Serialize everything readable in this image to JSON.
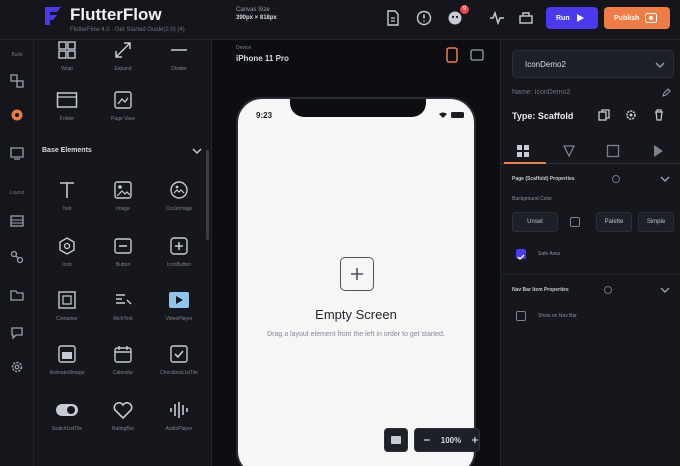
{
  "app": {
    "brand": "FlutterFlow",
    "brand_sub": "FlutterFlow 4.0 · Get Started Guide(2.0) (4)",
    "canvas_label": "Canvas Size",
    "canvas_value": "390px × 818px"
  },
  "toolbar": {
    "notification_count": "9",
    "run_label": "Run",
    "publish_label": "Publish"
  },
  "rail": {
    "build_label": "Build",
    "layout_label": "Layout"
  },
  "panel": {
    "top_row": [
      {
        "label": "Wrap",
        "icon": "grid-icon"
      },
      {
        "label": "Expand",
        "icon": "expand-icon"
      },
      {
        "label": "Divider",
        "icon": "divider-icon"
      }
    ],
    "second_row": [
      {
        "label": "Folder",
        "icon": "folder-icon"
      },
      {
        "label": "Page View",
        "icon": "page-view-icon"
      }
    ],
    "section_title": "Base Elements",
    "rows": [
      [
        {
          "label": "Text",
          "icon": "text-icon"
        },
        {
          "label": "Image",
          "icon": "image-icon"
        },
        {
          "label": "CircleImage",
          "icon": "circle-image-icon"
        }
      ],
      [
        {
          "label": "Icon",
          "icon": "hex-icon"
        },
        {
          "label": "Button",
          "icon": "button-icon"
        },
        {
          "label": "IconButton",
          "icon": "icon-button-icon"
        }
      ],
      [
        {
          "label": "Container",
          "icon": "container-icon"
        },
        {
          "label": "RichText",
          "icon": "rich-text-icon"
        },
        {
          "label": "VideoPlayer",
          "icon": "video-icon"
        }
      ],
      [
        {
          "label": "AnimatedImage",
          "icon": "animated-image-icon"
        },
        {
          "label": "Calendar",
          "icon": "calendar-icon"
        },
        {
          "label": "CheckboxListTile",
          "icon": "checkbox-icon"
        }
      ],
      [
        {
          "label": "SwitchListTile",
          "icon": "toggle-icon"
        },
        {
          "label": "RatingBar",
          "icon": "heart-icon"
        },
        {
          "label": "AudioPlayer",
          "icon": "waveform-icon"
        }
      ]
    ]
  },
  "canvas": {
    "device_label": "Device",
    "device_name": "iPhone 11 Pro",
    "time": "9:23",
    "empty_title": "Empty Screen",
    "empty_subtitle": "Drag a layout element from the left in order to get started.",
    "zoom": "100%"
  },
  "props": {
    "widget_name": "IconDemo2",
    "name_label": "Name: IconDemo2",
    "type_label": "Type: Scaffold",
    "page_props_title": "Page (Scaffold) Properties",
    "bg_color_label": "Background Color",
    "color_value": "Unset",
    "palette_label": "Palette",
    "simple_label": "Simple",
    "safe_area_label": "Safe Area",
    "nav_bar_title": "Nav Bar Item Properties",
    "show_nav_label": "Show on Nav Bar"
  },
  "colors": {
    "accent": "#4b39ef",
    "publish": "#ef7b45",
    "background": "#0f1014",
    "panel": "#16171c"
  }
}
